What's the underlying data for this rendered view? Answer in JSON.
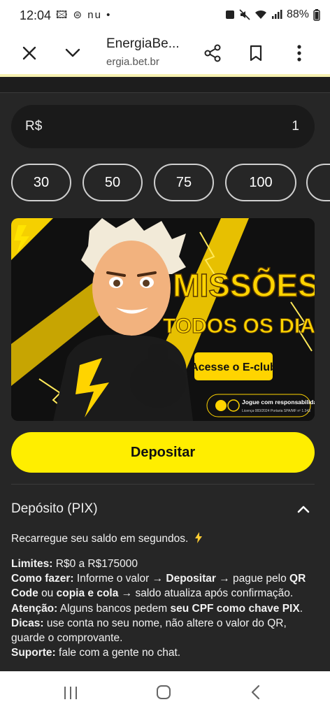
{
  "status_bar": {
    "time": "12:04",
    "notifications": "🖾 ⊜ nu •",
    "battery": "88%"
  },
  "browser": {
    "title": "EnergiaBe...",
    "url": "ergia.bet.br"
  },
  "deposit_form": {
    "currency": "R$",
    "amount": "1",
    "quick_amounts": [
      "30",
      "50",
      "75",
      "100"
    ],
    "deposit_button": "Depositar"
  },
  "banner": {
    "headline_1": "MISSÕES",
    "headline_2": "TODOS OS DIAS",
    "cta": "Acesse o E-club",
    "responsible": "Jogue com responsabilidade",
    "license": "Licença 083/2024 Portaria SPA/MF nº 1.343",
    "colors": {
      "accent": "#ffe400",
      "dark": "#111111"
    }
  },
  "accordion": {
    "title": "Depósito (PIX)",
    "intro": "Recarregue seu saldo em segundos.",
    "limits_label": "Limites:",
    "limits_value": "R$0 a R$175000",
    "how_label": "Como fazer:",
    "how_1": "Informe o valor →",
    "how_2": "Depositar",
    "how_3": "→ pague pelo",
    "how_4": "QR Code",
    "how_5": "ou",
    "how_6": "copia e cola",
    "how_7": "→ saldo atualiza após confirmação.",
    "attention_label": "Atenção:",
    "attention_1": "Alguns bancos pedem",
    "attention_2": "seu CPF como chave PIX",
    "attention_3": ".",
    "tips_label": "Dicas:",
    "tips_value": "use conta no seu nome, não altere o valor do QR, guarde o comprovante.",
    "support_label": "Suporte:",
    "support_value": "fale com a gente no chat."
  },
  "colors": {
    "primary": "#ffee00",
    "background": "#262626",
    "input_bg": "#1a1a1a"
  }
}
